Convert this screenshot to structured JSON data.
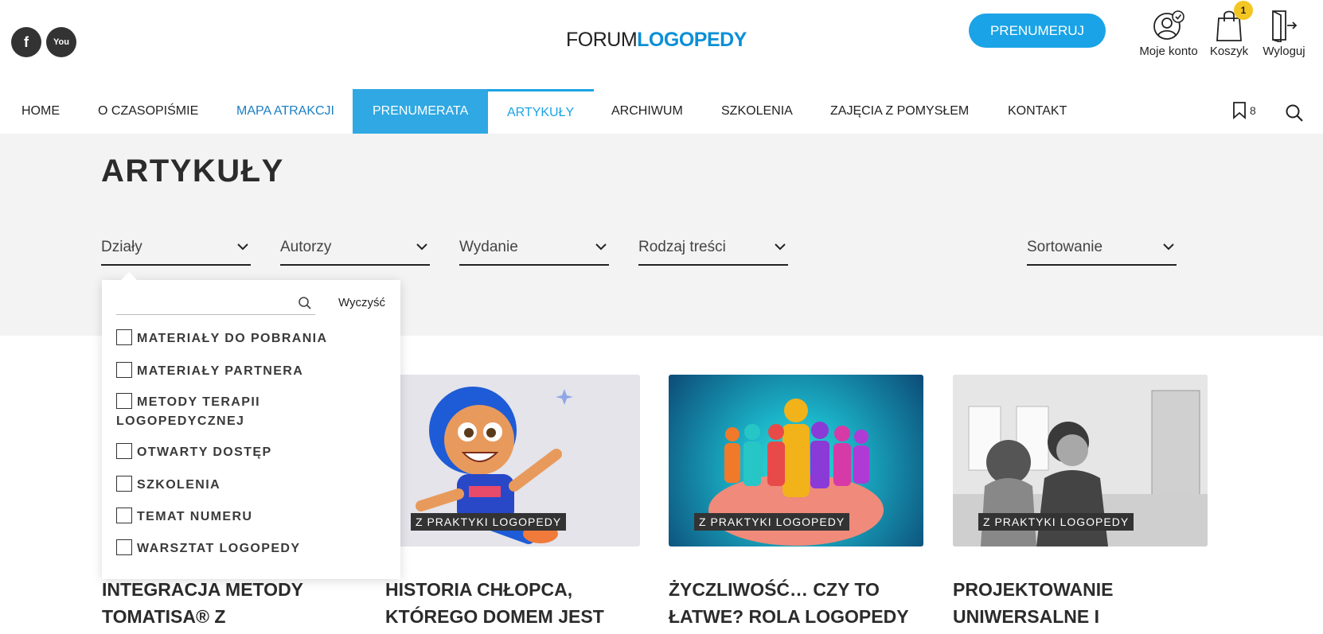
{
  "header": {
    "logo_part1": "FORUM",
    "logo_part2": "LOGOPEDY",
    "subscribe_label": "PRENUMERUJ",
    "account_label": "Moje konto",
    "cart_label": "Koszyk",
    "cart_count": "1",
    "logout_label": "Wyloguj",
    "social": [
      "facebook-icon",
      "youtube-icon"
    ]
  },
  "nav": {
    "items": [
      {
        "label": "HOME"
      },
      {
        "label": "O CZASOPIŚMIE"
      },
      {
        "label": "MAPA ATRAKCJI"
      },
      {
        "label": "PRENUMERATA"
      },
      {
        "label": "ARTYKUŁY"
      },
      {
        "label": "ARCHIWUM"
      },
      {
        "label": "SZKOLENIA"
      },
      {
        "label": "ZAJĘCIA Z POMYSŁEM"
      },
      {
        "label": "KONTAKT"
      }
    ],
    "bookmark_count": "8"
  },
  "page": {
    "title": "ARTYKUŁY"
  },
  "filters": {
    "items": [
      {
        "label": "Działy"
      },
      {
        "label": "Autorzy"
      },
      {
        "label": "Wydanie"
      },
      {
        "label": "Rodzaj treści"
      },
      {
        "label": "Sortowanie"
      }
    ]
  },
  "dropdown": {
    "search_value": "",
    "clear_label": "Wyczyść",
    "options": [
      {
        "label": "MATERIAŁY DO POBRANIA",
        "checked": false
      },
      {
        "label": "MATERIAŁY PARTNERA",
        "checked": false
      },
      {
        "label": "METODY TERAPII LOGOPEDYCZNEJ",
        "checked": false
      },
      {
        "label": "OTWARTY DOSTĘP",
        "checked": false
      },
      {
        "label": "SZKOLENIA",
        "checked": false
      },
      {
        "label": "TEMAT NUMERU",
        "checked": false
      },
      {
        "label": "WARSZTAT LOGOPEDY",
        "checked": false
      }
    ]
  },
  "articles": [
    {
      "badge": "",
      "title": "INTEGRACJA METODY TOMATISA® Z"
    },
    {
      "badge": "Z PRAKTYKI LOGOPEDY",
      "title": "HISTORIA CHŁOPCA, KTÓREGO DOMEM JEST"
    },
    {
      "badge": "Z PRAKTYKI LOGOPEDY",
      "title": "ŻYCZLIWOŚĆ… CZY TO ŁATWE? ROLA LOGOPEDY"
    },
    {
      "badge": "Z PRAKTYKI LOGOPEDY",
      "title": "PROJEKTOWANIE UNIWERSALNE I"
    }
  ],
  "colors": {
    "accent": "#1aa3e6",
    "nav_active_bg": "#2fa8e3",
    "logo_blue": "#0b8fd6",
    "cart_badge": "#f3c623"
  }
}
